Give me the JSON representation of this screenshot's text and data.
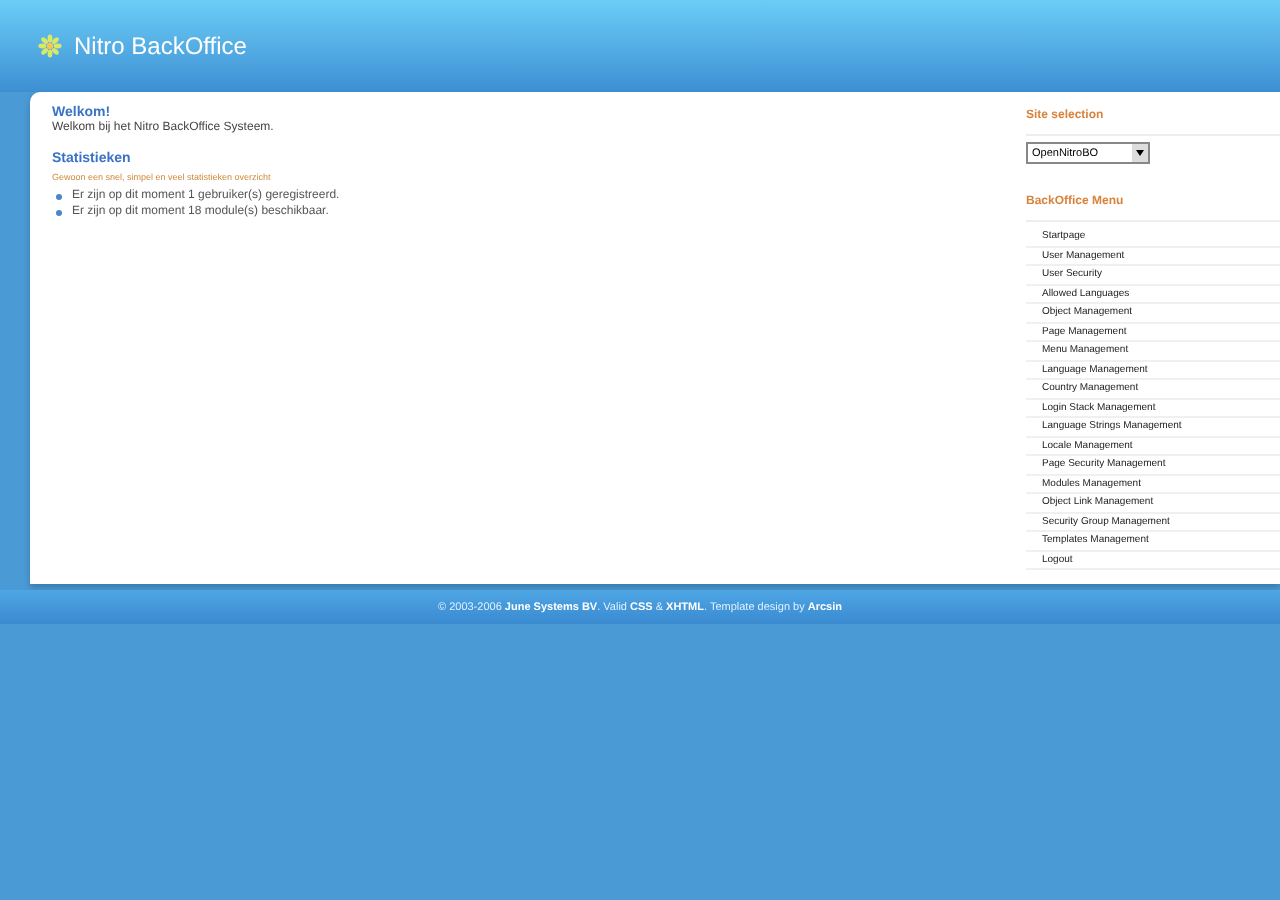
{
  "header": {
    "title": "Nitro BackOffice"
  },
  "main": {
    "welcome_title": "Welkom!",
    "welcome_text": "Welkom bij het Nitro BackOffice Systeem.",
    "stats_title": "Statistieken",
    "stats_subtitle": "Gewoon een snel, simpel en veel statistieken overzicht",
    "stats": [
      "Er zijn op dit moment 1 gebruiker(s) geregistreerd.",
      "Er zijn op dit moment 18 module(s) beschikbaar."
    ]
  },
  "sidebar": {
    "site_title": "Site selection",
    "site_value": "OpenNitroBO",
    "menu_title": "BackOffice Menu",
    "menu": [
      "Startpage",
      "User Management",
      "User Security",
      "Allowed Languages",
      "Object Management",
      "Page Management",
      "Menu Management",
      "Language Management",
      "Country Management",
      "Login Stack Management",
      "Language Strings Management",
      "Locale Management",
      "Page Security Management",
      "Modules Management",
      "Object Link Management",
      "Security Group Management",
      "Templates Management",
      "Logout"
    ]
  },
  "footer": "© 2003-2006 **June Systems BV**. Valid **CSS** & **XHTML**. Template design by **Arcsin**"
}
